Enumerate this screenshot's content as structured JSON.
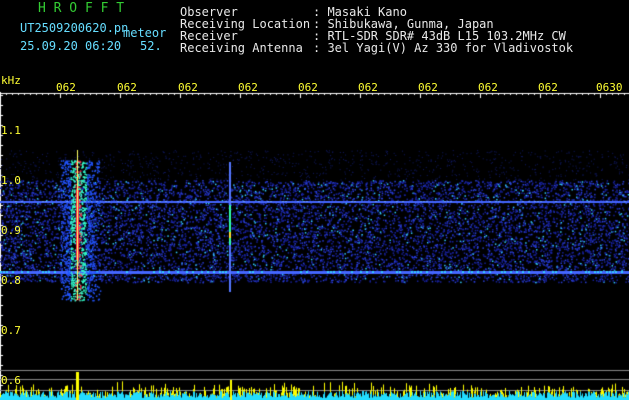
{
  "header": {
    "app_name": "H R O F F T",
    "filename": "UT2509200620.pn",
    "meteor_label": "meteor",
    "date_time": "25.09.20 06:20",
    "count": "52.",
    "info": [
      {
        "label": "Observer",
        "value": ": Masaki Kano"
      },
      {
        "label": "Receiving Location",
        "value": ": Shibukawa, Gunma, Japan"
      },
      {
        "label": "Receiver",
        "value": ": RTL-SDR SDR# 43dB L15 103.2MHz CW"
      },
      {
        "label": "Receiving Antenna",
        "value": ": 3el Yagi(V) Az 330 for Vladivostok"
      }
    ]
  },
  "axis": {
    "unit": "kHz",
    "y_ticks": [
      "1.1",
      "1.0",
      "0.9",
      "0.8",
      "0.7",
      "0.6"
    ],
    "x_ticks": [
      "062",
      "062",
      "062",
      "062",
      "062",
      "062",
      "062",
      "062",
      "062",
      "0630"
    ]
  },
  "colors": {
    "background": "#000000",
    "noise": "#2233cc",
    "signal": "#33ccff",
    "hot": "#ff3355",
    "bars": "#ffff00"
  }
}
